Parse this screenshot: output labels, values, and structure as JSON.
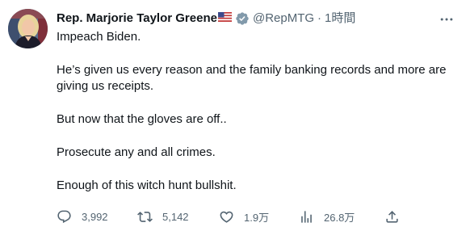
{
  "tweet": {
    "author": {
      "display_name": "Rep. Marjorie Taylor Greene",
      "handle": "@RepMTG",
      "separator": "·",
      "time": "1時間",
      "flag_icon": "us-flag-icon",
      "verified_icon": "verified-badge-icon"
    },
    "text": [
      "Impeach Biden.",
      "He’s given us every reason and the family banking records and more are giving us receipts.",
      "But now that the gloves are off..",
      "Prosecute any and all crimes.",
      "Enough of this witch hunt bullshit."
    ],
    "actions": {
      "reply": {
        "icon": "reply-icon",
        "count": "3,992"
      },
      "retweet": {
        "icon": "retweet-icon",
        "count": "5,142"
      },
      "like": {
        "icon": "heart-icon",
        "count": "1.9万"
      },
      "views": {
        "icon": "views-icon",
        "count": "26.8万"
      },
      "share": {
        "icon": "share-icon"
      }
    },
    "more_icon": "more-icon",
    "colors": {
      "text": "#0f1419",
      "secondary": "#536471",
      "verified": "#829aab"
    }
  }
}
